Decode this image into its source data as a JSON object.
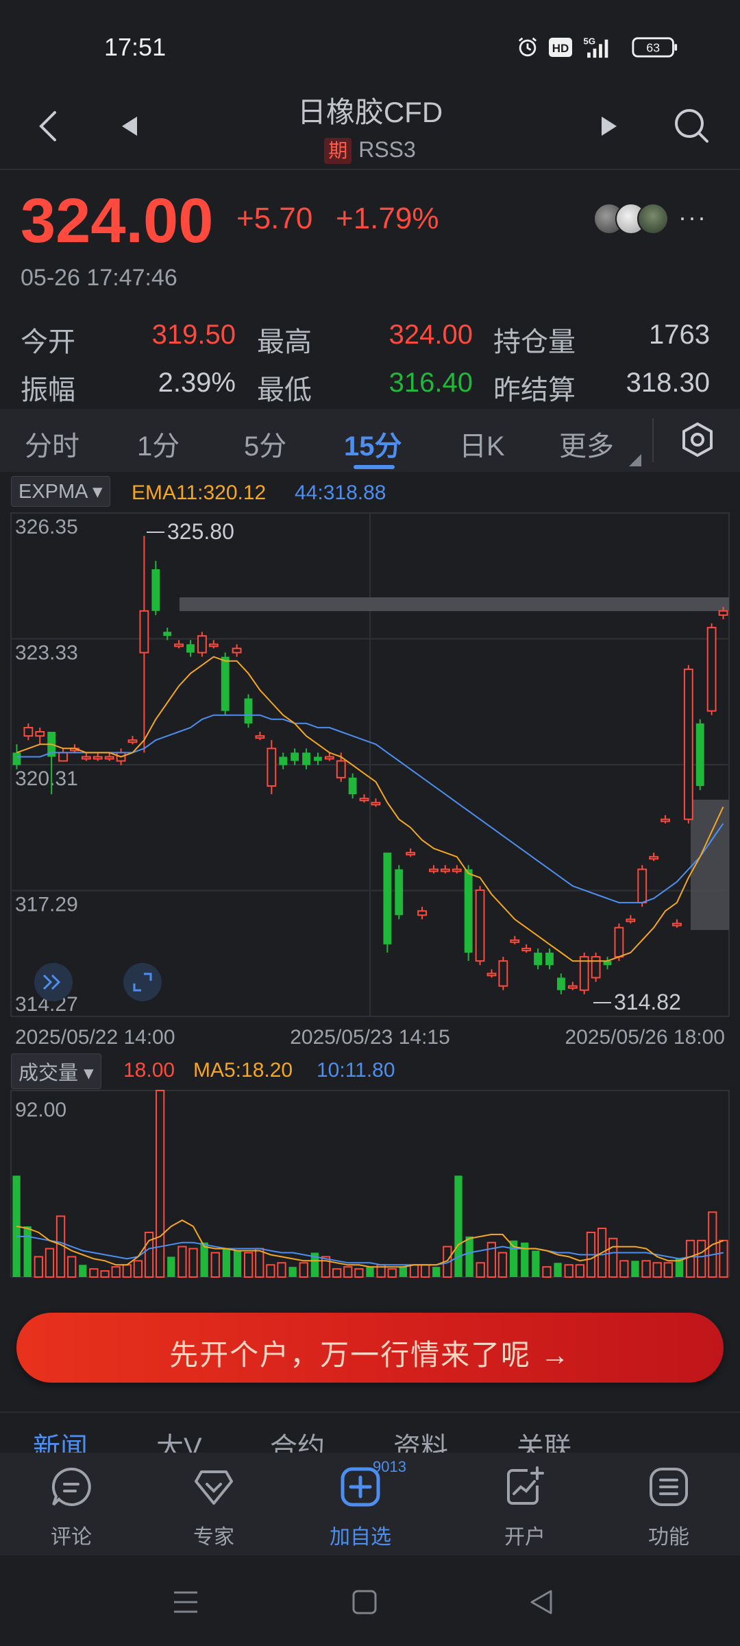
{
  "status_bar": {
    "time": "17:51",
    "battery": "63",
    "network": "5G"
  },
  "header": {
    "title": "日橡胶CFD",
    "tag": "期",
    "code": "RSS3"
  },
  "quote": {
    "last_price": "324.00",
    "change_abs": "+5.70",
    "change_pct": "+1.79%",
    "time": "05-26 17:47:46"
  },
  "stats": [
    {
      "label": "今开",
      "value": "319.50",
      "color": "#ff4a3d"
    },
    {
      "label": "最高",
      "value": "324.00",
      "color": "#ff4a3d"
    },
    {
      "label": "持仓量",
      "value": "1763",
      "color": "#c9ccd3"
    },
    {
      "label": "振幅",
      "value": "2.39%",
      "color": "#c9ccd3"
    },
    {
      "label": "最低",
      "value": "316.40",
      "color": "#1fb83a"
    },
    {
      "label": "昨结算",
      "value": "318.30",
      "color": "#c9ccd3"
    }
  ],
  "tabs": [
    {
      "label": "分时",
      "active": false
    },
    {
      "label": "1分",
      "active": false
    },
    {
      "label": "5分",
      "active": false
    },
    {
      "label": "15分",
      "active": true
    },
    {
      "label": "日K",
      "active": false
    },
    {
      "label": "更多",
      "active": false
    }
  ],
  "indicator": {
    "name": "EXPMA",
    "ema11_label": "EMA11:320.12",
    "ema44_label": "44:318.88",
    "ema11_color": "#f5a623",
    "ema44_color": "#4d8ff0"
  },
  "volume_indicator": {
    "name": "成交量",
    "vol_label": "18.00",
    "ma5_label": "MA5:18.20",
    "ma10_label": "10:11.80"
  },
  "chart_data": {
    "type": "candlestick",
    "ylim": [
      314.27,
      326.35
    ],
    "y_ticks": [
      "326.35",
      "323.33",
      "320.31",
      "317.29",
      "314.27"
    ],
    "x_ticks": [
      "2025/05/22 14:00",
      "2025/05/23 14:15",
      "2025/05/26 18:00"
    ],
    "high_label": "325.80",
    "low_label": "314.82",
    "up_color": "#ff4a3d",
    "down_color": "#1fb83a",
    "candles": [
      [
        320.6,
        320.3,
        320.8,
        320.2
      ],
      [
        321.0,
        321.2,
        321.3,
        320.9
      ],
      [
        321.0,
        321.1,
        321.2,
        320.8
      ],
      [
        321.1,
        320.5,
        321.1,
        319.6
      ],
      [
        320.4,
        320.6,
        320.7,
        320.4
      ],
      [
        320.7,
        320.7,
        320.8,
        320.6
      ],
      [
        320.5,
        320.5,
        320.6,
        320.4
      ],
      [
        320.5,
        320.5,
        320.6,
        320.4
      ],
      [
        320.5,
        320.5,
        320.6,
        320.4
      ],
      [
        320.4,
        320.6,
        320.7,
        320.3
      ],
      [
        320.9,
        320.9,
        321.0,
        320.8
      ],
      [
        323.0,
        324.0,
        325.8,
        320.6
      ],
      [
        325.0,
        324.0,
        325.2,
        323.9
      ],
      [
        323.5,
        323.4,
        323.6,
        323.3
      ],
      [
        323.2,
        323.2,
        323.3,
        323.1
      ],
      [
        323.2,
        323.0,
        323.3,
        322.9
      ],
      [
        323.0,
        323.4,
        323.5,
        322.9
      ],
      [
        323.2,
        323.2,
        323.3,
        323.1
      ],
      [
        322.9,
        321.6,
        323.0,
        321.5
      ],
      [
        323.0,
        323.1,
        323.2,
        322.9
      ],
      [
        321.9,
        321.3,
        322.0,
        321.2
      ],
      [
        321.0,
        321.0,
        321.1,
        320.9
      ],
      [
        319.8,
        320.7,
        320.9,
        319.6
      ],
      [
        320.5,
        320.3,
        320.6,
        320.2
      ],
      [
        320.6,
        320.4,
        320.7,
        320.3
      ],
      [
        320.6,
        320.3,
        320.7,
        320.2
      ],
      [
        320.5,
        320.4,
        320.6,
        320.3
      ],
      [
        320.5,
        320.5,
        320.6,
        320.4
      ],
      [
        320.0,
        320.4,
        320.6,
        319.9
      ],
      [
        320.0,
        319.6,
        320.1,
        319.5
      ],
      [
        319.5,
        319.5,
        319.6,
        319.4
      ],
      [
        319.4,
        319.4,
        319.5,
        319.3
      ],
      [
        318.2,
        316.0,
        318.2,
        315.8
      ],
      [
        317.8,
        316.7,
        317.9,
        316.6
      ],
      [
        318.2,
        318.2,
        318.3,
        318.1
      ],
      [
        316.7,
        316.8,
        316.9,
        316.6
      ],
      [
        317.8,
        317.8,
        317.9,
        317.7
      ],
      [
        317.8,
        317.8,
        317.9,
        317.7
      ],
      [
        317.8,
        317.8,
        317.9,
        317.7
      ],
      [
        317.8,
        315.8,
        317.9,
        315.6
      ],
      [
        315.6,
        317.3,
        317.4,
        315.5
      ],
      [
        315.3,
        315.3,
        315.4,
        315.2
      ],
      [
        315.0,
        315.6,
        315.7,
        314.9
      ],
      [
        316.1,
        316.1,
        316.2,
        316.0
      ],
      [
        315.9,
        315.9,
        316.0,
        315.8
      ],
      [
        315.8,
        315.5,
        315.9,
        315.4
      ],
      [
        315.8,
        315.5,
        315.9,
        315.4
      ],
      [
        315.2,
        314.9,
        315.3,
        314.8
      ],
      [
        315.0,
        315.0,
        315.1,
        314.9
      ],
      [
        314.9,
        315.7,
        315.8,
        314.8
      ],
      [
        315.2,
        315.7,
        315.8,
        315.1
      ],
      [
        315.6,
        315.5,
        315.7,
        315.4
      ],
      [
        315.7,
        316.4,
        316.5,
        315.6
      ],
      [
        316.6,
        316.6,
        316.7,
        316.5
      ],
      [
        317.0,
        317.8,
        317.9,
        316.9
      ],
      [
        318.1,
        318.1,
        318.2,
        318.0
      ],
      [
        319.0,
        319.0,
        319.1,
        318.9
      ],
      [
        316.5,
        316.5,
        316.6,
        316.4
      ],
      [
        319.0,
        322.6,
        322.7,
        318.9
      ],
      [
        321.3,
        319.8,
        321.4,
        319.7
      ],
      [
        321.6,
        323.6,
        323.7,
        321.5
      ],
      [
        323.9,
        324.0,
        324.1,
        323.8
      ]
    ],
    "ema11": [
      320.6,
      320.7,
      320.8,
      320.8,
      320.7,
      320.7,
      320.6,
      320.6,
      320.6,
      320.5,
      320.6,
      320.9,
      321.4,
      321.8,
      322.2,
      322.5,
      322.7,
      322.9,
      322.8,
      322.8,
      322.5,
      322.1,
      321.8,
      321.5,
      321.3,
      321.0,
      320.8,
      320.6,
      320.5,
      320.3,
      320.1,
      319.9,
      319.4,
      319.0,
      318.8,
      318.5,
      318.3,
      318.2,
      318.1,
      317.7,
      317.6,
      317.2,
      316.9,
      316.6,
      316.4,
      316.2,
      316.0,
      315.8,
      315.6,
      315.6,
      315.6,
      315.6,
      315.7,
      315.8,
      316.1,
      316.4,
      316.8,
      317.0,
      317.6,
      318.1,
      318.7,
      319.3
    ],
    "ema44": [
      320.5,
      320.5,
      320.5,
      320.6,
      320.6,
      320.6,
      320.6,
      320.6,
      320.6,
      320.6,
      320.6,
      320.7,
      320.9,
      321.0,
      321.1,
      321.2,
      321.4,
      321.5,
      321.5,
      321.5,
      321.5,
      321.5,
      321.4,
      321.4,
      321.3,
      321.3,
      321.2,
      321.2,
      321.1,
      321.0,
      320.9,
      320.8,
      320.6,
      320.4,
      320.2,
      320.0,
      319.8,
      319.6,
      319.4,
      319.2,
      319.0,
      318.8,
      318.6,
      318.4,
      318.2,
      318.0,
      317.8,
      317.6,
      317.4,
      317.3,
      317.2,
      317.1,
      317.0,
      317.0,
      317.0,
      317.1,
      317.3,
      317.5,
      317.8,
      318.1,
      318.5,
      318.9
    ],
    "volume": {
      "ylim": [
        0,
        92
      ],
      "y_tick": "92.00",
      "values": [
        50,
        25,
        10,
        14,
        30,
        10,
        6,
        4,
        3,
        5,
        6,
        8,
        22,
        92,
        10,
        15,
        14,
        17,
        12,
        14,
        13,
        12,
        14,
        6,
        7,
        5,
        7,
        12,
        10,
        4,
        5,
        4,
        5,
        6,
        4,
        5,
        6,
        6,
        5,
        15,
        50,
        20,
        7,
        17,
        12,
        18,
        17,
        13,
        5,
        7,
        6,
        6,
        22,
        24,
        19,
        8,
        8,
        8,
        7,
        7,
        9,
        18,
        18,
        32,
        18
      ],
      "up": [
        false,
        false,
        true,
        true,
        true,
        true,
        false,
        true,
        true,
        true,
        true,
        true,
        true,
        true,
        false,
        true,
        true,
        false,
        true,
        false,
        false,
        true,
        true,
        true,
        true,
        false,
        true,
        false,
        true,
        true,
        true,
        true,
        false,
        true,
        true,
        false,
        true,
        true,
        false,
        true,
        false,
        false,
        true,
        true,
        true,
        false,
        false,
        false,
        true,
        false,
        true,
        true,
        true,
        true,
        true,
        true,
        false,
        true,
        true,
        true,
        false,
        true,
        true,
        true,
        true
      ],
      "ma5": [
        25,
        24,
        22,
        18,
        16,
        13,
        11,
        9,
        8,
        6,
        6,
        10,
        18,
        20,
        25,
        28,
        25,
        15,
        14,
        14,
        13,
        13,
        13,
        11,
        10,
        9,
        8,
        8,
        8,
        7,
        6,
        6,
        5,
        5,
        5,
        5,
        6,
        6,
        6,
        8,
        16,
        19,
        20,
        21,
        21,
        15,
        14,
        14,
        13,
        11,
        10,
        8,
        9,
        12,
        15,
        15,
        15,
        14,
        10,
        8,
        8,
        10,
        12,
        16,
        18
      ],
      "ma10": [
        20,
        20,
        19,
        18,
        17,
        15,
        13,
        12,
        11,
        10,
        9,
        10,
        14,
        15,
        16,
        17,
        17,
        16,
        15,
        14,
        14,
        14,
        14,
        13,
        12,
        12,
        11,
        10,
        9,
        8,
        7,
        7,
        7,
        6,
        6,
        6,
        6,
        6,
        6,
        7,
        10,
        12,
        13,
        14,
        15,
        14,
        14,
        14,
        13,
        12,
        12,
        11,
        11,
        11,
        12,
        12,
        12,
        12,
        11,
        10,
        9,
        10,
        10,
        11,
        12
      ]
    }
  },
  "cta": {
    "text": "先开个户，万一行情来了呢 →"
  },
  "news_tabs": [
    {
      "label": "新闻",
      "active": true
    },
    {
      "label": "大V",
      "active": false
    },
    {
      "label": "合约",
      "active": false
    },
    {
      "label": "资料",
      "active": false
    },
    {
      "label": "关联",
      "active": false
    }
  ],
  "bottom_bar": [
    {
      "label": "评论",
      "icon": "comment-icon",
      "active": false
    },
    {
      "label": "专家",
      "icon": "diamond-icon",
      "active": false
    },
    {
      "label": "加自选",
      "icon": "add-watchlist-icon",
      "active": true,
      "badge": "9013"
    },
    {
      "label": "开户",
      "icon": "open-account-icon",
      "active": false
    },
    {
      "label": "功能",
      "icon": "menu-list-icon",
      "active": false
    }
  ]
}
